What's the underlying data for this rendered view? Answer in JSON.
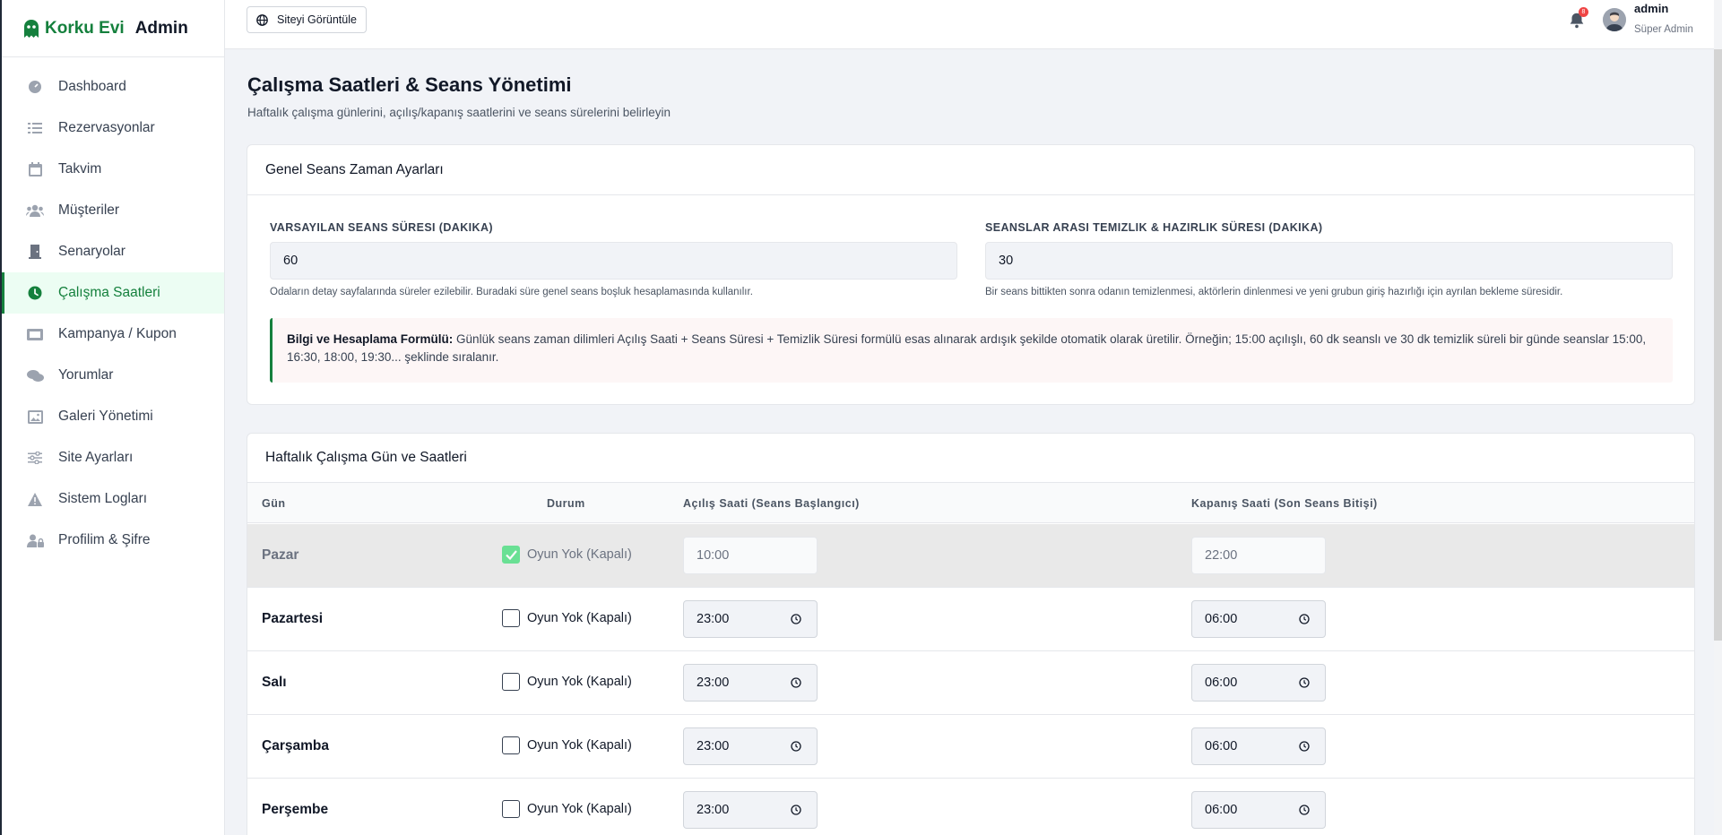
{
  "brand": {
    "name": "Korku Evi",
    "suffix": "Admin"
  },
  "sidebar": {
    "items": [
      {
        "label": "Dashboard",
        "icon": "gauge-icon"
      },
      {
        "label": "Rezervasyonlar",
        "icon": "list-icon"
      },
      {
        "label": "Takvim",
        "icon": "calendar-icon"
      },
      {
        "label": "Müşteriler",
        "icon": "users-icon"
      },
      {
        "label": "Senaryolar",
        "icon": "door-icon"
      },
      {
        "label": "Çalışma Saatleri",
        "icon": "clock-icon",
        "active": true
      },
      {
        "label": "Kampanya / Kupon",
        "icon": "ticket-icon"
      },
      {
        "label": "Yorumlar",
        "icon": "comments-icon"
      },
      {
        "label": "Galeri Yönetimi",
        "icon": "image-icon"
      },
      {
        "label": "Site Ayarları",
        "icon": "sliders-icon"
      },
      {
        "label": "Sistem Logları",
        "icon": "warning-icon"
      },
      {
        "label": "Profilim & Şifre",
        "icon": "user-lock-icon"
      }
    ]
  },
  "topbar": {
    "site_button": "Siteyi Görüntüle",
    "notification_count": "8",
    "user_name": "admin",
    "user_role": "Süper Admin"
  },
  "page": {
    "title": "Çalışma Saatleri & Seans Yönetimi",
    "subtitle": "Haftalık çalışma günlerini, açılış/kapanış saatlerini ve seans sürelerini belirleyin"
  },
  "general": {
    "title": "Genel Seans Zaman Ayarları",
    "session_label": "Varsayılan Seans Süresi (Dakika)",
    "session_value": "60",
    "session_help": "Odaların detay sayfalarında süreler ezilebilir. Buradaki süre genel seans boşluk hesaplamasında kullanılır.",
    "cleanup_label": "Seanslar Arası Temizlik & Hazırlık Süresi (Dakika)",
    "cleanup_value": "30",
    "cleanup_help": "Bir seans bittikten sonra odanın temizlenmesi, aktörlerin dinlenmesi ve yeni grubun giriş hazırlığı için ayrılan bekleme süresidir.",
    "info_bold": "Bilgi ve Hesaplama Formülü:",
    "info_text": " Günlük seans zaman dilimleri Açılış Saati + Seans Süresi + Temizlik Süresi formülü esas alınarak ardışık şekilde otomatik olarak üretilir. Örneğin; 15:00 açılışlı, 60 dk seanslı ve 30 dk temizlik süreli bir günde seanslar 15:00, 16:30, 18:00, 19:30... şeklinde sıralanır."
  },
  "weekly": {
    "title": "Haftalık Çalışma Gün ve Saatleri",
    "headers": {
      "day": "Gün",
      "status": "Durum",
      "open": "Açılış Saati (Seans Başlangıcı)",
      "close": "Kapanış Saati (Son Seans Bitişi)"
    },
    "closed_label": "Oyun Yok (Kapalı)",
    "rows": [
      {
        "day": "Pazar",
        "closed": true,
        "open": "10:00",
        "close": "22:00"
      },
      {
        "day": "Pazartesi",
        "closed": false,
        "open": "23:00",
        "close": "06:00"
      },
      {
        "day": "Salı",
        "closed": false,
        "open": "23:00",
        "close": "06:00"
      },
      {
        "day": "Çarşamba",
        "closed": false,
        "open": "23:00",
        "close": "06:00"
      },
      {
        "day": "Perşembe",
        "closed": false,
        "open": "23:00",
        "close": "06:00"
      }
    ]
  }
}
